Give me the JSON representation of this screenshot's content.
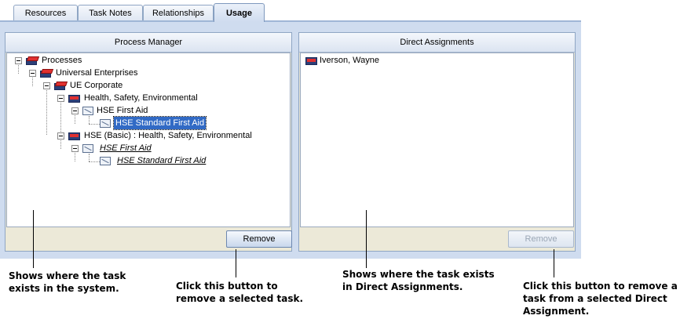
{
  "tabs": [
    {
      "label": "Resources"
    },
    {
      "label": "Task Notes"
    },
    {
      "label": "Relationships"
    },
    {
      "label": "Usage"
    }
  ],
  "process_manager": {
    "header": "Process Manager",
    "tree": [
      {
        "label": "Processes"
      },
      {
        "label": "Universal Enterprises"
      },
      {
        "label": "UE Corporate"
      },
      {
        "label": "Health, Safety, Environmental"
      },
      {
        "label": "HSE  First Aid"
      },
      {
        "label": "HSE  Standard First Aid"
      },
      {
        "label": "HSE (Basic) : Health, Safety, Environmental"
      },
      {
        "label": "HSE  First Aid"
      },
      {
        "label": "HSE  Standard First Aid"
      }
    ],
    "remove_label": "Remove"
  },
  "direct_assignments": {
    "header": "Direct Assignments",
    "items": [
      {
        "label": "Iverson, Wayne"
      }
    ],
    "remove_label": "Remove"
  },
  "annotations": {
    "a1_l1": "Shows where the task",
    "a1_l2": "exists in the system.",
    "a2_l1": "Click this button to",
    "a2_l2": "remove a selected task.",
    "a3_l1": "Shows where the task exists",
    "a3_l2": "in Direct Assignments.",
    "a4_l1": "Click this button to remove a",
    "a4_l2": "task from a selected Direct",
    "a4_l3": "Assignment."
  },
  "colors": {
    "selection": "#316ac5",
    "frame": "#cfdcef"
  }
}
